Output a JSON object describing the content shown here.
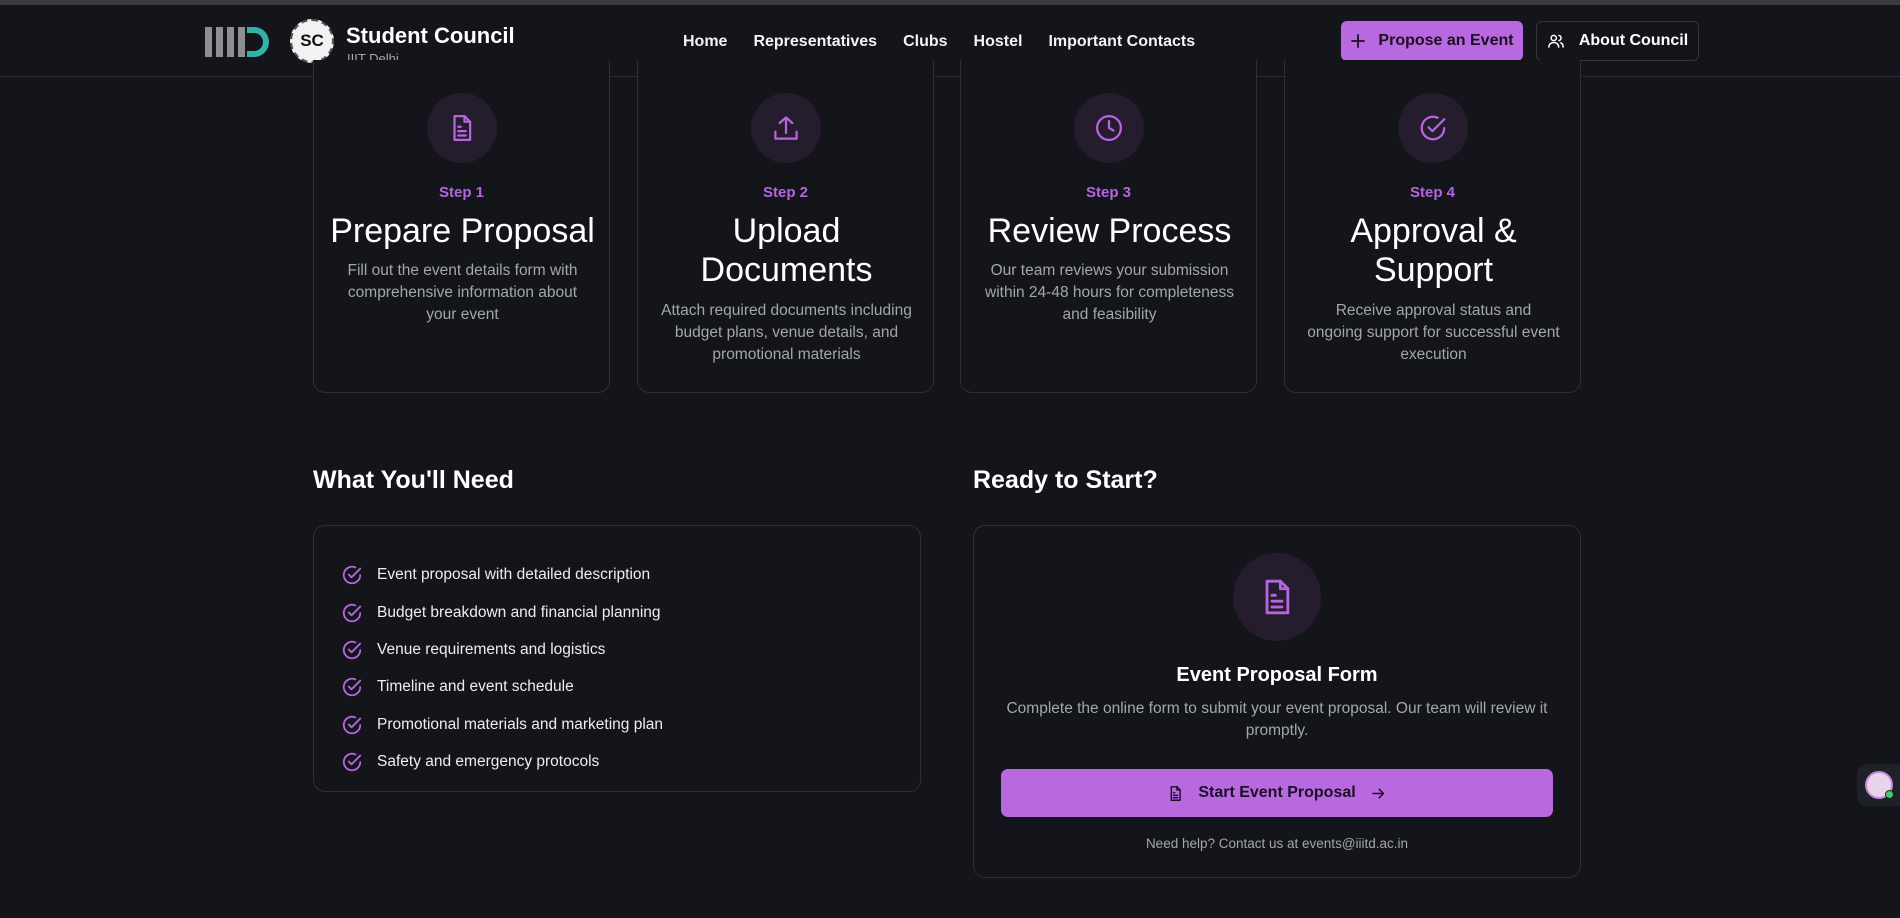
{
  "header": {
    "brand_title": "Student Council",
    "brand_subtitle": "IIIT Delhi",
    "seal_text": "SC",
    "nav": [
      "Home",
      "Representatives",
      "Clubs",
      "Hostel",
      "Important Contacts"
    ],
    "propose_label": "Propose an Event",
    "about_label": "About Council",
    "accent_color": "#b869e0"
  },
  "steps": [
    {
      "num": "Step 1",
      "title": "Prepare Proposal",
      "desc": "Fill out the event details form with comprehensive information about your event",
      "icon": "document-icon"
    },
    {
      "num": "Step 2",
      "title": "Upload Documents",
      "desc": "Attach required documents including budget plans, venue details, and promotional materials",
      "icon": "upload-icon"
    },
    {
      "num": "Step 3",
      "title": "Review Process",
      "desc": "Our team reviews your submission within 24-48 hours for completeness and feasibility",
      "icon": "clock-icon"
    },
    {
      "num": "Step 4",
      "title": "Approval & Support",
      "desc": "Receive approval status and ongoing support for successful event execution",
      "icon": "check-circle-icon"
    }
  ],
  "needs": {
    "heading": "What You'll Need",
    "items": [
      "Event proposal with detailed description",
      "Budget breakdown and financial planning",
      "Venue requirements and logistics",
      "Timeline and event schedule",
      "Promotional materials and marketing plan",
      "Safety and emergency protocols"
    ]
  },
  "ready": {
    "heading": "Ready to Start?",
    "title": "Event Proposal Form",
    "desc": "Complete the online form to submit your event proposal. Our team will review it promptly.",
    "button_label": "Start Event Proposal",
    "help": "Need help? Contact us at events@iiitd.ac.in"
  }
}
